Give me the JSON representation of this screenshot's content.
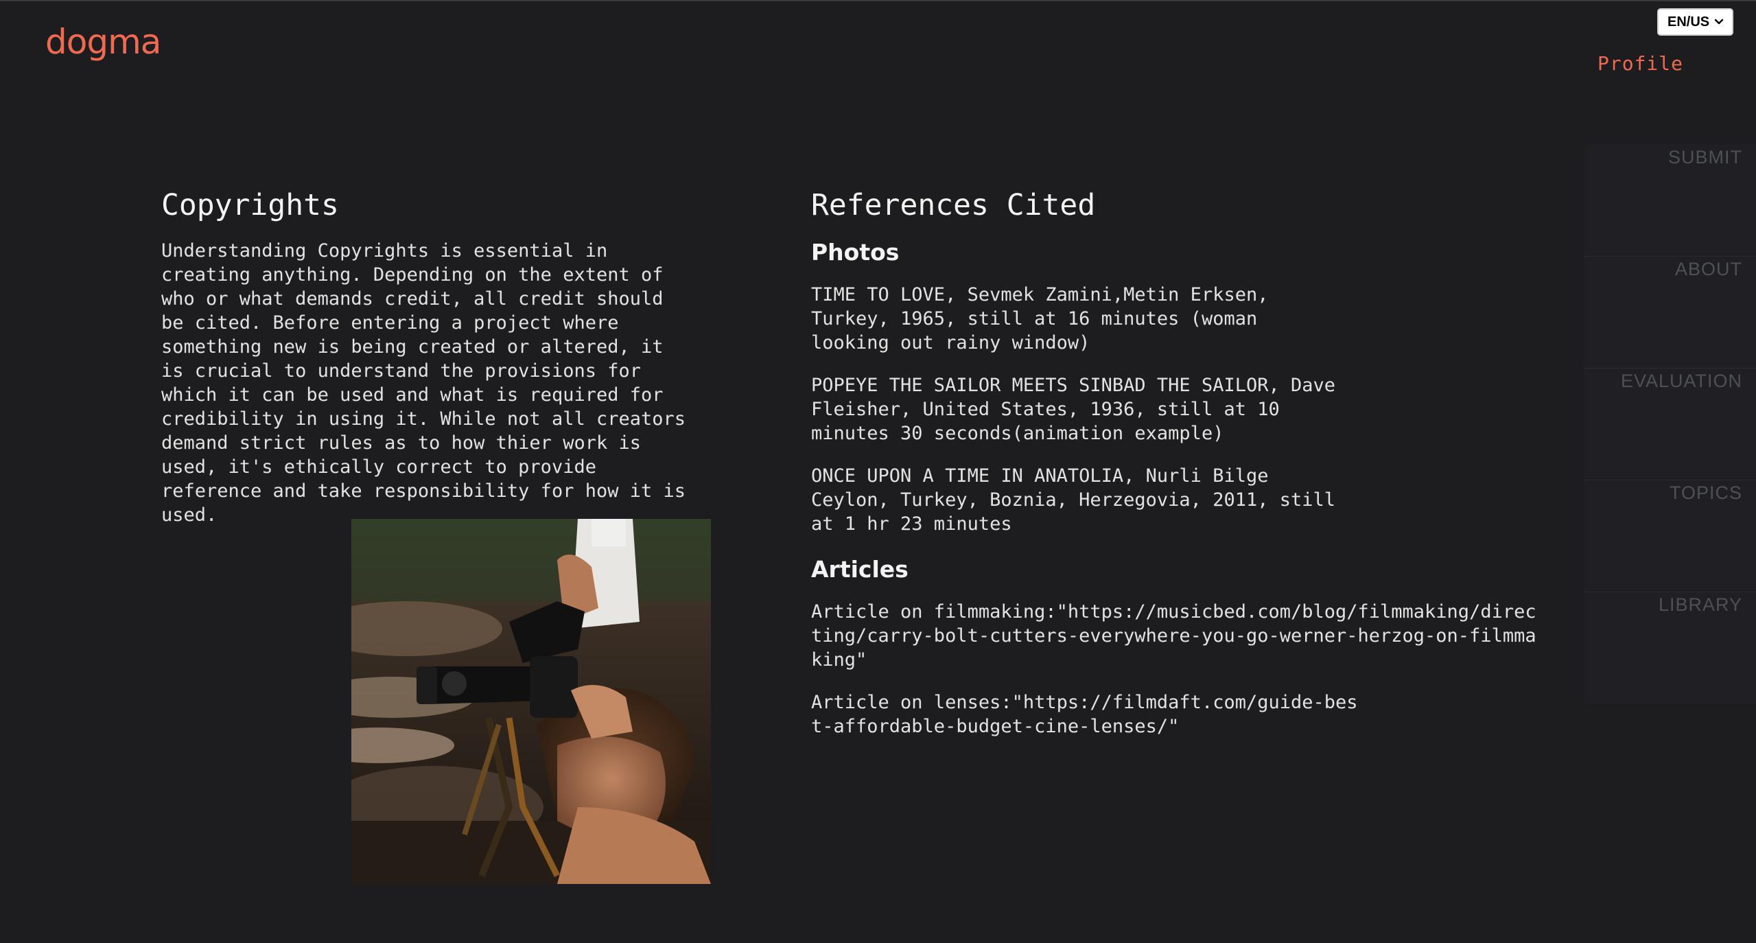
{
  "brand": {
    "logo_text": "dogma",
    "accent_color": "#f06a51"
  },
  "header": {
    "language": {
      "selected": "EN/US",
      "icon": "chevron-down-icon"
    },
    "profile_label": "Profile"
  },
  "side_nav": {
    "items": [
      {
        "label": "SUBMIT"
      },
      {
        "label": "ABOUT"
      },
      {
        "label": "EVALUATION"
      },
      {
        "label": "TOPICS"
      },
      {
        "label": "LIBRARY"
      }
    ]
  },
  "copyrights": {
    "title": "Copyrights",
    "body": "Understanding Copyrights is essential in creating anything. Depending on the extent of who or what demands credit, all credit should be cited. Before entering a project where something new is being created or altered, it is crucial to understand the provisions for which it can be used and what is required for credibility in using it. While not all creators demand strict rules as to how thier work is used, it's ethically correct to provide reference and take responsibility for how it is used."
  },
  "references": {
    "title": "References Cited",
    "photos": {
      "title": "Photos",
      "items": [
        "TIME TO LOVE, Sevmek Zamini,Metin Erksen, Turkey, 1965, still at 16 minutes (woman looking out rainy window)",
        "POPEYE THE SAILOR MEETS SINBAD THE SAILOR, Dave Fleisher, United States, 1936, still at 10 minutes 30 seconds(animation example)",
        "ONCE UPON A TIME IN ANATOLIA, Nurli Bilge Ceylon, Turkey, Boznia, Herzegovia, 2011, still at 1 hr 23 minutes"
      ]
    },
    "articles": {
      "title": "Articles",
      "items": [
        "Article on filmmaking:\"https://musicbed.com/blog/filmmaking/directing/carry-bolt-cutters-everywhere-you-go-werner-herzog-on-filmmaking\"",
        "Article on lenses:\"https://filmdaft.com/guide-best-affordable-budget-cine-lenses/\""
      ]
    }
  }
}
